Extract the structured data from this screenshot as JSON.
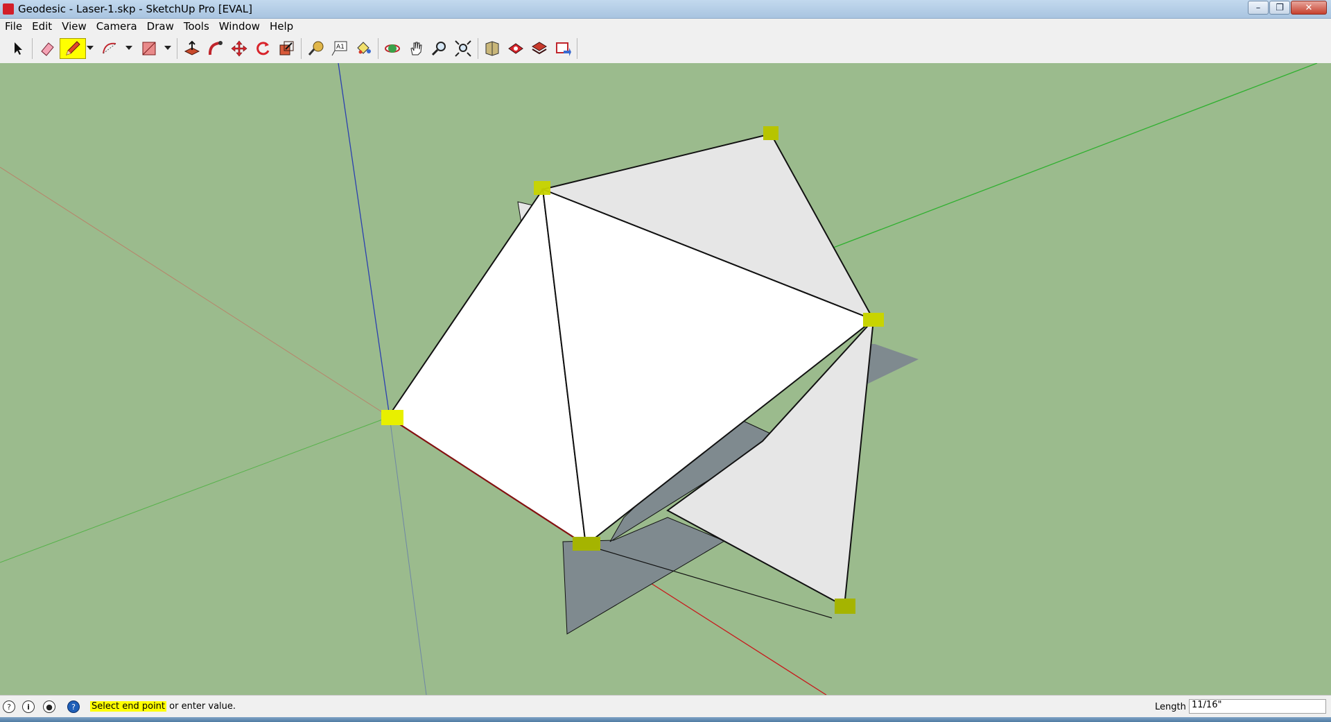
{
  "window": {
    "title": "Geodesic - Laser-1.skp - SketchUp Pro [EVAL]",
    "buttons": {
      "minimize": "–",
      "maximize": "❐",
      "close": "✕"
    }
  },
  "menu": [
    "File",
    "Edit",
    "View",
    "Camera",
    "Draw",
    "Tools",
    "Window",
    "Help"
  ],
  "toolbar": {
    "tools": [
      {
        "name": "select",
        "icon": "arrow-cursor-icon"
      },
      {
        "name": "eraser",
        "icon": "eraser-icon"
      },
      {
        "name": "line",
        "icon": "pencil-icon",
        "active": true
      },
      {
        "name": "arc",
        "icon": "arc-icon"
      },
      {
        "name": "rectangle",
        "icon": "rectangle-icon"
      },
      {
        "name": "push-pull",
        "icon": "push-pull-icon"
      },
      {
        "name": "follow-me",
        "icon": "follow-me-icon"
      },
      {
        "name": "move",
        "icon": "move-icon"
      },
      {
        "name": "rotate",
        "icon": "rotate-icon"
      },
      {
        "name": "scale",
        "icon": "scale-icon"
      },
      {
        "name": "tape-measure",
        "icon": "tape-measure-icon"
      },
      {
        "name": "text",
        "icon": "text-icon"
      },
      {
        "name": "paint-bucket",
        "icon": "paint-bucket-icon"
      },
      {
        "name": "orbit",
        "icon": "orbit-icon"
      },
      {
        "name": "pan",
        "icon": "pan-icon"
      },
      {
        "name": "zoom",
        "icon": "zoom-icon"
      },
      {
        "name": "zoom-extents",
        "icon": "zoom-extents-icon"
      },
      {
        "name": "3d-warehouse",
        "icon": "warehouse-icon"
      },
      {
        "name": "share-model",
        "icon": "share-model-icon"
      },
      {
        "name": "get-models",
        "icon": "get-models-icon"
      },
      {
        "name": "extension-warehouse",
        "icon": "extension-warehouse-icon"
      }
    ],
    "accent": "#ffff00"
  },
  "status": {
    "highlight": "Select end point",
    "rest": " or enter value.",
    "vcb_label": "Length",
    "vcb_value": "11/16\""
  },
  "colors": {
    "ground": "#9bbb8d",
    "face_front": "#ffffff",
    "face_back": "#e6e6e6",
    "shadow": "#7f8a8f",
    "axis_red": "#c8191c",
    "axis_green": "#3bb33b",
    "axis_blue": "#2a3fb0",
    "endpoint_marker": "#ddee00"
  }
}
